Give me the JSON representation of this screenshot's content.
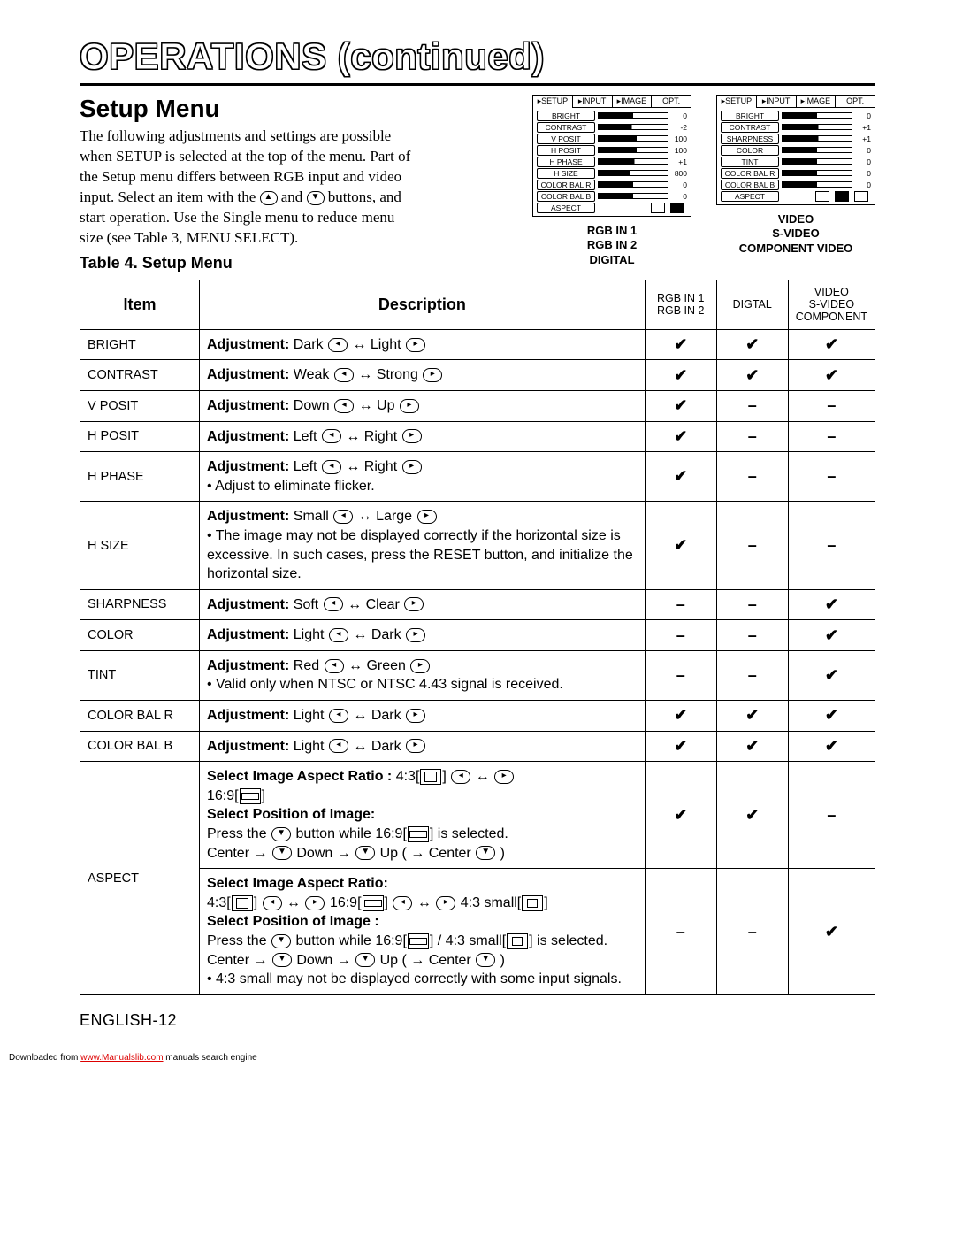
{
  "title": "OPERATIONS (continued)",
  "setup": {
    "heading": "Setup Menu",
    "paragraph_pre": "The following adjustments and settings are possible when SETUP is selected at the top of the menu. Part of the Setup menu differs between RGB input and video input. Select an item with the ",
    "and": " and ",
    "paragraph_post": " buttons, and start operation. Use the Single menu to reduce menu size (see Table 3, MENU SELECT).",
    "tablelabel": "Table 4. Setup Menu"
  },
  "osd": {
    "tabs": [
      "SETUP",
      "INPUT",
      "IMAGE",
      "OPT."
    ],
    "left": {
      "rows": [
        {
          "label": "BRIGHT",
          "p": 50,
          "v": "0"
        },
        {
          "label": "CONTRAST",
          "p": 48,
          "v": "-2"
        },
        {
          "label": "V POSIT",
          "p": 55,
          "v": "100"
        },
        {
          "label": "H POSIT",
          "p": 55,
          "v": "100"
        },
        {
          "label": "H PHASE",
          "p": 52,
          "v": "+1"
        },
        {
          "label": "H SIZE",
          "p": 45,
          "v": "800"
        },
        {
          "label": "COLOR BAL R",
          "p": 50,
          "v": "0"
        },
        {
          "label": "COLOR BAL B",
          "p": 50,
          "v": "0"
        }
      ],
      "aspect": "ASPECT",
      "captions": [
        "RGB IN 1",
        "RGB IN 2",
        "DIGITAL"
      ]
    },
    "right": {
      "rows": [
        {
          "label": "BRIGHT",
          "p": 50,
          "v": "0"
        },
        {
          "label": "CONTRAST",
          "p": 52,
          "v": "+1"
        },
        {
          "label": "SHARPNESS",
          "p": 52,
          "v": "+1"
        },
        {
          "label": "COLOR",
          "p": 50,
          "v": "0"
        },
        {
          "label": "TINT",
          "p": 50,
          "v": "0"
        },
        {
          "label": "COLOR BAL R",
          "p": 50,
          "v": "0"
        },
        {
          "label": "COLOR BAL B",
          "p": 50,
          "v": "0"
        }
      ],
      "aspect": "ASPECT",
      "captions": [
        "VIDEO",
        "S-VIDEO",
        "COMPONENT VIDEO"
      ]
    }
  },
  "table": {
    "headers": {
      "item": "Item",
      "desc": "Description",
      "c1": "RGB IN 1\nRGB IN 2",
      "c2": "DIGTAL",
      "c3": "VIDEO\nS-VIDEO\nCOMPONENT"
    },
    "rows": [
      {
        "item": "BRIGHT",
        "adj_label": "Adjustment:",
        "adj_a": "Dark",
        "adj_b": "Light",
        "note": "",
        "c": [
          "✔",
          "✔",
          "✔"
        ]
      },
      {
        "item": "CONTRAST",
        "adj_label": "Adjustment:",
        "adj_a": "Weak",
        "adj_b": "Strong",
        "note": "",
        "c": [
          "✔",
          "✔",
          "✔"
        ]
      },
      {
        "item": "V POSIT",
        "adj_label": "Adjustment:",
        "adj_a": "Down",
        "adj_b": "Up",
        "note": "",
        "c": [
          "✔",
          "–",
          "–"
        ]
      },
      {
        "item": "H POSIT",
        "adj_label": "Adjustment:",
        "adj_a": "Left",
        "adj_b": "Right",
        "note": "",
        "c": [
          "✔",
          "–",
          "–"
        ]
      },
      {
        "item": "H PHASE",
        "adj_label": "Adjustment:",
        "adj_a": "Left",
        "adj_b": "Right",
        "note": "• Adjust to eliminate flicker.",
        "c": [
          "✔",
          "–",
          "–"
        ]
      },
      {
        "item": "H SIZE",
        "adj_label": "Adjustment:",
        "adj_a": "Small",
        "adj_b": "Large",
        "note": "• The image may not be displayed correctly if the horizontal size is excessive. In such cases, press the RESET button, and initialize the horizontal size.",
        "c": [
          "✔",
          "–",
          "–"
        ]
      },
      {
        "item": "SHARPNESS",
        "adj_label": "Adjustment:",
        "adj_a": "Soft",
        "adj_b": "Clear",
        "note": "",
        "c": [
          "–",
          "–",
          "✔"
        ]
      },
      {
        "item": "COLOR",
        "adj_label": "Adjustment:",
        "adj_a": "Light",
        "adj_b": "Dark",
        "note": "",
        "c": [
          "–",
          "–",
          "✔"
        ]
      },
      {
        "item": "TINT",
        "adj_label": "Adjustment:",
        "adj_a": "Red",
        "adj_b": "Green",
        "note": "• Valid only when NTSC or NTSC 4.43 signal is received.",
        "c": [
          "–",
          "–",
          "✔"
        ]
      },
      {
        "item": "COLOR BAL R",
        "adj_label": "Adjustment:",
        "adj_a": "Light",
        "adj_b": "Dark",
        "note": "",
        "c": [
          "✔",
          "✔",
          "✔"
        ]
      },
      {
        "item": "COLOR BAL B",
        "adj_label": "Adjustment:",
        "adj_a": "Light",
        "adj_b": "Dark",
        "note": "",
        "c": [
          "✔",
          "✔",
          "✔"
        ]
      }
    ],
    "aspect": {
      "item": "ASPECT",
      "block1": {
        "l1a": "Select Image Aspect Ratio :",
        "l1b": "4:3[",
        "l1c": "]",
        "l1d": "16:9[",
        "l1e": "]",
        "l2": "Select Position of Image:",
        "l3a": "Press the ",
        "l3b": " button while 16:9[",
        "l3c": "] is selected.",
        "l4a": "Center → ",
        "l4b": " Down → ",
        "l4c": " Up ( → Center ",
        "l4d": " )",
        "c": [
          "✔",
          "✔",
          "–"
        ]
      },
      "block2": {
        "l1": "Select Image Aspect Ratio:",
        "l2a": "4:3[",
        "l2b": "]",
        "l2c": "16:9[",
        "l2d": "]",
        "l2e": "4:3 small[",
        "l2f": "]",
        "l3": "Select Position of Image :",
        "l4a": "Press the ",
        "l4b": " button while 16:9[",
        "l4c": "] / 4:3 small[",
        "l4d": "] is selected.",
        "l5a": "Center → ",
        "l5b": " Down → ",
        "l5c": " Up ( → Center ",
        "l5d": " )",
        "l6": "• 4:3 small may not be displayed correctly with some input signals.",
        "c": [
          "–",
          "–",
          "✔"
        ]
      }
    }
  },
  "footer": "ENGLISH-12",
  "download": {
    "pre": "Downloaded from ",
    "link": "www.Manualslib.com",
    "post": " manuals search engine"
  }
}
